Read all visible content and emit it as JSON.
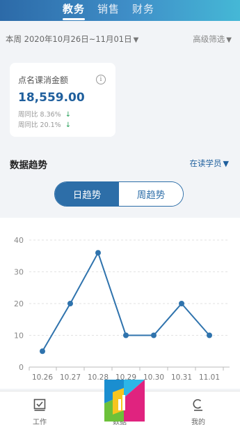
{
  "header": {
    "tabs": [
      {
        "label": "教务",
        "active": true
      },
      {
        "label": "销售",
        "active": false
      },
      {
        "label": "财务",
        "active": false
      }
    ]
  },
  "date_range": "本周 2020年10月26日~11月01日",
  "advanced_filter": "高级筛选",
  "card": {
    "title": "点名课消金额",
    "value": "18,559.00",
    "week_compare": "周同比 8.36%",
    "week_compare_2": "周同比 20.1%",
    "trend_arrow": "↓"
  },
  "trend": {
    "title": "数据趋势",
    "filter": "在读学员",
    "seg_day": "日趋势",
    "seg_week": "周趋势"
  },
  "chart_data": {
    "type": "line",
    "x": [
      "10.26",
      "10.27",
      "10.28",
      "10.29",
      "10.30",
      "10.31",
      "11.01"
    ],
    "values": [
      5,
      20,
      36,
      10,
      10,
      20,
      10
    ],
    "yticks": [
      0,
      10,
      20,
      30,
      40
    ],
    "ylim": [
      0,
      40
    ],
    "grid": true,
    "color": "#2f73ad"
  },
  "bottom_nav": {
    "work": "工作",
    "data": "数据",
    "mine": "我的"
  }
}
